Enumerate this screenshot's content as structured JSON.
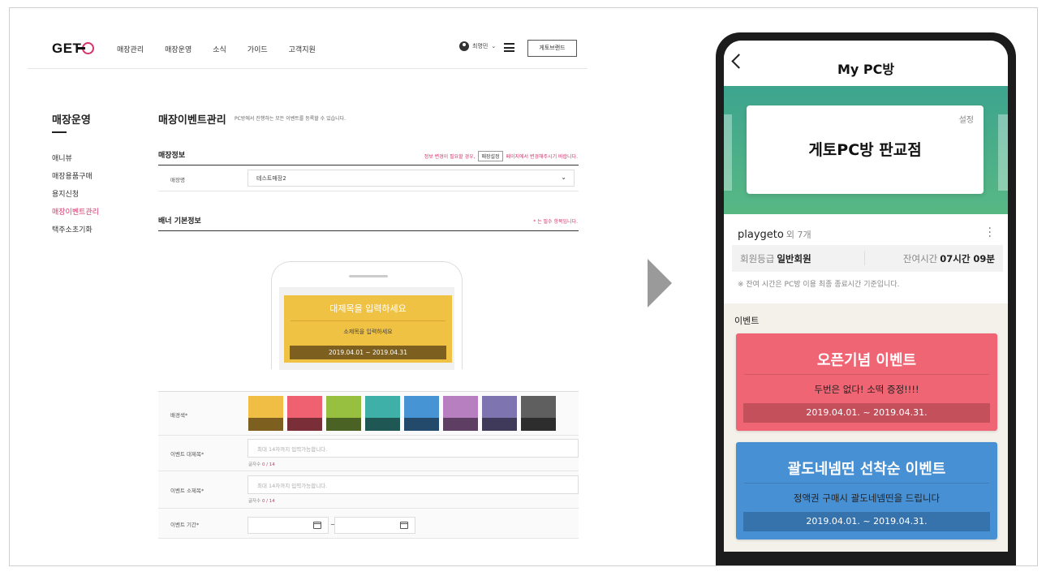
{
  "desktop": {
    "logo": "GET",
    "nav": [
      "매장관리",
      "매장운영",
      "소식",
      "가이드",
      "고객지원"
    ],
    "user_name": "최명민",
    "brand_button": "게토브랜드",
    "sidebar": {
      "title": "매장운영",
      "items": [
        {
          "label": "애니뷰",
          "active": false
        },
        {
          "label": "매장용품구매",
          "active": false
        },
        {
          "label": "용지신청",
          "active": false
        },
        {
          "label": "매장이벤트관리",
          "active": true
        },
        {
          "label": "택주소초기화",
          "active": false
        }
      ]
    },
    "page_title": "매장이벤트관리",
    "page_desc": "PC방에서 진행하는 모든 이벤트를 등록할 수 있습니다.",
    "store_info": {
      "heading": "매장정보",
      "note_before": "정보 변경이 필요할 경우,",
      "note_button": "매장설정",
      "note_after": "페이지에서 변경해주시기 바랍니다.",
      "store_label": "매장명",
      "store_value": "테스트매장2"
    },
    "banner_info": {
      "heading": "배너 기본정보",
      "required_note": "* 는 필수 항목입니다."
    },
    "preview": {
      "title_placeholder": "대제목을 입력하세요",
      "subtitle_placeholder": "소제목을 입력하세요",
      "date_range": "2019.04.01 ~ 2019.04.31",
      "bg_color": "#f0c244",
      "date_bg": "#7d6020"
    },
    "form": {
      "bg_label": "배경색*",
      "swatches": [
        {
          "top": "#f0be45",
          "bottom": "#7d6020"
        },
        {
          "top": "#ef6070",
          "bottom": "#7a2e38"
        },
        {
          "top": "#97c040",
          "bottom": "#4a6224"
        },
        {
          "top": "#3fb0a8",
          "bottom": "#1e5754"
        },
        {
          "top": "#4694d4",
          "bottom": "#234a6b"
        },
        {
          "top": "#b87fc0",
          "bottom": "#5e3f63"
        },
        {
          "top": "#7e74b0",
          "bottom": "#403a5a"
        },
        {
          "top": "#5f5f60",
          "bottom": "#2d2d2d"
        }
      ],
      "title_label": "이벤트 대제목*",
      "title_placeholder": "최대 14자까지 입력가능합니다.",
      "title_count_label": "글자수",
      "title_count": "0 / 14",
      "sub_label": "이벤트 소제목*",
      "sub_placeholder": "최대 14자까지 입력가능합니다.",
      "sub_count_label": "글자수",
      "sub_count": "0 / 14",
      "period_label": "이벤트 기간*",
      "period_sep": "~"
    }
  },
  "mobile": {
    "header_title": "My PC방",
    "card_setting": "설정",
    "store_name": "게토PC방 판교점",
    "user_id": "playgeto",
    "user_extra": "외 7개",
    "grade_label": "회원등급",
    "grade_value": "일반회원",
    "time_label": "잔여시간",
    "time_value": "07시간 09분",
    "notice": "※ 잔여 시간은 PC방 이용 최종 종료시간 기준입니다.",
    "events_label": "이벤트",
    "events": [
      {
        "title": "오픈기념 이벤트",
        "subtitle": "두번은 없다! 소떡 증정!!!!",
        "date": "2019.04.01. ~ 2019.04.31.",
        "bg": "#ef6574",
        "date_bg": "#c4505c"
      },
      {
        "title": "괄도네넴띤 선착순 이벤트",
        "subtitle": "정액권 구매시 괄도네넴띤을 드립니다",
        "date": "2019.04.01. ~ 2019.04.31.",
        "bg": "#4890d4",
        "date_bg": "#3673ad"
      }
    ]
  }
}
